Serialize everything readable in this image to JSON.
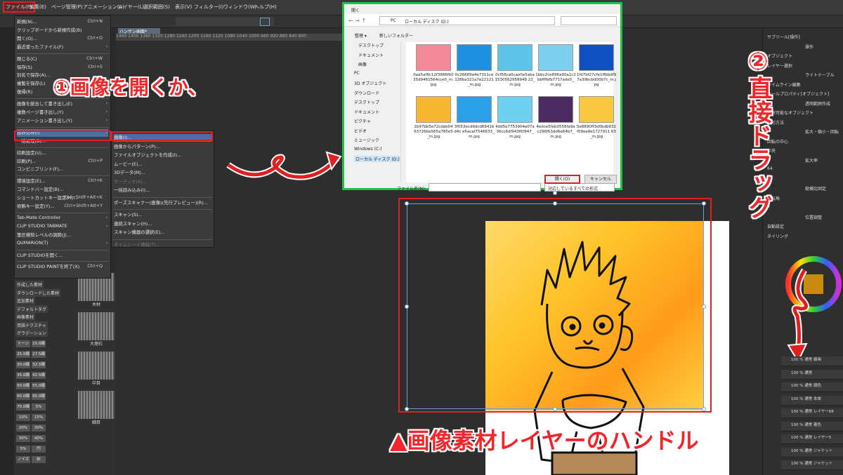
{
  "menubar": [
    "ファイル(F)",
    "編集(E)",
    "ページ管理(P)",
    "アニメーション(A)",
    "レイヤー(L)",
    "選択範囲(S)",
    "表示(V)",
    "フィルター(I)",
    "ウィンドウ(W)",
    "ヘルプ(H)"
  ],
  "doc_tab": "ハンサン画面*",
  "ruler": "1440 1400 1360 1320 1280 1240 1200 1160 1120 1080 1040 1000 960 920 880 840 800",
  "file_menu": [
    {
      "label": "新規(N)...",
      "shortcut": "Ctrl+N"
    },
    {
      "label": "クリップボードから新規作成(B)"
    },
    {
      "label": "開く(O)...",
      "shortcut": "Ctrl+O"
    },
    {
      "label": "最近使ったファイル(F)",
      "arrow": true
    },
    {
      "sep": true
    },
    {
      "label": "閉じる(C)",
      "shortcut": "Ctrl+W"
    },
    {
      "label": "保存(S)",
      "shortcut": "Ctrl+S"
    },
    {
      "label": "別名で保存(A)..."
    },
    {
      "label": "複製を保存(L)",
      "arrow": true
    },
    {
      "label": "復帰(R)"
    },
    {
      "sep": true
    },
    {
      "label": "画像を統合して書き出し(E)",
      "arrow": true
    },
    {
      "label": "複数ページ書き出し(Y)",
      "arrow": true
    },
    {
      "label": "アニメーション書き出し(Y)",
      "arrow": true
    },
    {
      "sep": true
    },
    {
      "label": "読み込み(I)",
      "arrow": true,
      "selected": true
    },
    {
      "label": "一括処理(B)..."
    },
    {
      "sep": true
    },
    {
      "label": "印刷設定(U)..."
    },
    {
      "label": "印刷(P)...",
      "shortcut": "Ctrl+P"
    },
    {
      "label": "コンビニプリント(F)..."
    },
    {
      "sep": true
    },
    {
      "label": "環境設定(E)...",
      "shortcut": "Ctrl+K"
    },
    {
      "label": "コマンドバー設定(B)..."
    },
    {
      "label": "ショートカットキー設定(H)...",
      "shortcut": "Ctrl+Shift+Alt+K"
    },
    {
      "label": "修飾キー設定(Y)...",
      "shortcut": "Ctrl+Shift+Alt+Y"
    },
    {
      "sep": true
    },
    {
      "label": "Tab-Mate Controller",
      "arrow": true
    },
    {
      "label": "CLIP STUDIO TABMATE",
      "arrow": true
    },
    {
      "label": "筆圧検知レベルの調節(J)..."
    },
    {
      "label": "QUMARION(T)",
      "arrow": true
    },
    {
      "sep": true
    },
    {
      "label": "CLIP STUDIOを開く..."
    },
    {
      "sep": true
    },
    {
      "label": "CLIP STUDIO PAINTを終了(X)",
      "shortcut": "Ctrl+Q"
    }
  ],
  "import_submenu": [
    {
      "label": "画像(I)...",
      "selected": true
    },
    {
      "label": "画像からパターン(P)..."
    },
    {
      "label": "ファイルオブジェクトを作成(I)..."
    },
    {
      "label": "ムービー(E)..."
    },
    {
      "label": "3Dデータ(M)..."
    },
    {
      "label": "オーディオ(A)...",
      "disabled": true
    },
    {
      "label": "一括読み込み(I)..."
    },
    {
      "sep": true
    },
    {
      "label": "ポーズスキャナー(画像)(先行プレビュー)(R)..."
    },
    {
      "sep": true
    },
    {
      "label": "スキャン(S)..."
    },
    {
      "label": "連続スキャン(H)..."
    },
    {
      "label": "スキャン機器の選択(E)..."
    },
    {
      "sep": true
    },
    {
      "label": "タイムシート情報(T)...",
      "disabled": true
    }
  ],
  "materials": {
    "items": [
      "作成した素材",
      "ダウンロードした素材",
      "追加素材",
      "デフォルトタグ",
      "画像素材",
      "用語テクスチャ",
      "グラデーション"
    ],
    "tones": [
      [
        "トーン",
        "15.0線"
      ],
      [
        "25.0線",
        "27.5線"
      ],
      [
        "30.0線",
        "32.5線"
      ],
      [
        "35.0線",
        "42.5線"
      ],
      [
        "50.0線",
        "55.0線"
      ],
      [
        "60.0線",
        "65.0線"
      ],
      [
        "75.0線",
        "5%"
      ],
      [
        "10%",
        "15%"
      ],
      [
        "20%",
        "30%"
      ],
      [
        "30%",
        "40%"
      ],
      [
        "5%",
        "円"
      ],
      [
        "ノイズ",
        "砂"
      ]
    ],
    "textures": [
      "木材",
      "大理石",
      "中目",
      "細目"
    ]
  },
  "dialog": {
    "title": "開く",
    "path": [
      "PC",
      "ローカル ディスク (D:)"
    ],
    "organize": "整理 ▾",
    "new_folder": "新しいフォルダー",
    "nav": [
      "デスクトップ",
      "ドキュメント",
      "画像",
      "PC",
      "3D オブジェクト",
      "ダウンロード",
      "デスクトップ",
      "ドキュメント",
      "ピクチャ",
      "ビデオ",
      "ミュージック",
      "Windows (C:)",
      "ローカル ディスク (D:)"
    ],
    "files": [
      {
        "name": "0aa5af8c12f3986fb035d9461564cce0_m.jpg",
        "color": "#f28a9a"
      },
      {
        "name": "0c26689a4e7311ce128ba321a7e22121_m.jpg",
        "color": "#1f8fe0"
      },
      {
        "name": "0cf58ca0cae0e5aba1530562958948 22_m.jpg",
        "color": "#5fc3ea"
      },
      {
        "name": "1bbc2ce896a90a1c2bbfffbfb7717ade5_m.jpg",
        "color": "#7fd0f0"
      },
      {
        "name": "1fd7bf27cfe1ffbbdf97a39bcbd00b7c_m.jpg",
        "color": "#1050c0"
      },
      {
        "name": "2b97bb5e72cdde0463726be565a785e5_m.jpg",
        "color": "#f6b830"
      },
      {
        "name": "3f053ecd9dcd6641bd4c e5acaf7546633_m.jpg",
        "color": "#2aa0e8"
      },
      {
        "name": "4dd5e7753904e07a36cc6df943f6f947_m.jpg",
        "color": "#70d0f0"
      },
      {
        "name": "4edce5feb0556fa9ac296f63dd6e64b7_m.jpg",
        "color": "#4a2a60"
      },
      {
        "name": "5e8890ff3d0bdb932f09ee8e1727911 63_m.jpg",
        "color": "#f7c840"
      }
    ],
    "filename_label": "ファイル名(N):",
    "filter": "対応しているすべての形式",
    "open": "開く(O)",
    "cancel": "キャンセル"
  },
  "right_panel": {
    "items": [
      "サブツール[操作]",
      "操作",
      "オブジェクト",
      "レイヤー選択",
      "ライトテーブル",
      "タイムライン編集",
      "ツールプロパティ[オブジェクト]",
      "透明範囲作成",
      "選択可能なオブジェクト",
      "変形方法",
      "拡大・縮小・回転",
      "回転の中心",
      "中央",
      "拡大率",
      "64",
      "64",
      "縦横比固定",
      "回転角",
      "0",
      "位置調整",
      "自動設定",
      "タイリング"
    ],
    "layers": [
      "100 % 通常 線画",
      "100 % 通常",
      "100 % 通常 顔色",
      "100 % 通常 本体",
      "100 % 通常 レイヤー68",
      "100 % 通常 着色",
      "100 % 通常 レイヤー5",
      "100 % 通常 ジャケット",
      "100 % 通常 ジャケット"
    ]
  },
  "annotations": {
    "step1": "①画像を開くか、",
    "step2": "②直接ドラッグ",
    "handle": "▲画像素材レイヤーのハンドル"
  }
}
